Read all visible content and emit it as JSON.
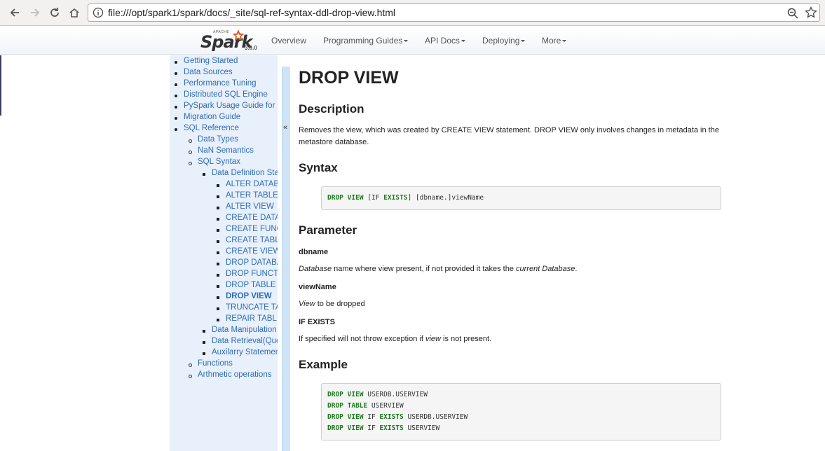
{
  "browser": {
    "url": "file:///opt/spark1/spark/docs/_site/sql-ref-syntax-ddl-drop-view.html"
  },
  "navbar": {
    "logo_small": "APACHE",
    "logo_text": "Spark",
    "version": "3.0.0",
    "items": [
      "Overview",
      "Programming Guides",
      "API Docs",
      "Deploying",
      "More"
    ]
  },
  "sidebar": {
    "items": [
      {
        "label": "Getting Started",
        "level": 0
      },
      {
        "label": "Data Sources",
        "level": 0
      },
      {
        "label": "Performance Tuning",
        "level": 0
      },
      {
        "label": "Distributed SQL Engine",
        "level": 0
      },
      {
        "label": "PySpark Usage Guide for P",
        "level": 0
      },
      {
        "label": "Migration Guide",
        "level": 0
      },
      {
        "label": "SQL Reference",
        "level": 0
      },
      {
        "label": "Data Types",
        "level": 1
      },
      {
        "label": "NaN Semantics",
        "level": 1
      },
      {
        "label": "SQL Syntax",
        "level": 1
      },
      {
        "label": "Data Definition Sta",
        "level": 2
      },
      {
        "label": "ALTER DATAB",
        "level": 3
      },
      {
        "label": "ALTER TABLE",
        "level": 3
      },
      {
        "label": "ALTER VIEW",
        "level": 3
      },
      {
        "label": "CREATE DATA",
        "level": 3
      },
      {
        "label": "CREATE FUNC",
        "level": 3
      },
      {
        "label": "CREATE TABL",
        "level": 3
      },
      {
        "label": "CREATE VIEW",
        "level": 3
      },
      {
        "label": "DROP DATABA",
        "level": 3
      },
      {
        "label": "DROP FUNCT",
        "level": 3
      },
      {
        "label": "DROP TABLE",
        "level": 3
      },
      {
        "label": "DROP VIEW",
        "level": 3,
        "active": true
      },
      {
        "label": "TRUNCATE TA",
        "level": 3
      },
      {
        "label": "REPAIR TABL",
        "level": 3
      },
      {
        "label": "Data Manipulation",
        "level": 2
      },
      {
        "label": "Data Retrieval(Que",
        "level": 2
      },
      {
        "label": "Auxilarry Statemen",
        "level": 2
      },
      {
        "label": "Functions",
        "level": 1
      },
      {
        "label": "Arthmetic operations",
        "level": 1
      }
    ],
    "collapse_glyph": "«"
  },
  "content": {
    "title": "DROP VIEW",
    "description_heading": "Description",
    "description_text": "Removes the view, which was created by CREATE VIEW statement. DROP VIEW only involves changes in metadata in the metastore database.",
    "syntax_heading": "Syntax",
    "syntax_code": {
      "kw1": "DROP",
      "kw2": "VIEW",
      "t1": " [IF ",
      "kw3": "EXISTS",
      "t2": "] [dbname.]viewName"
    },
    "parameter_heading": "Parameter",
    "params": [
      {
        "name": "dbname",
        "desc_em1": "Database",
        "desc_mid": " name where view present, if not provided it takes the ",
        "desc_em2": "current Database",
        "desc_end": "."
      },
      {
        "name": "viewName",
        "desc_em1": "View",
        "desc_mid": " to be dropped",
        "desc_em2": "",
        "desc_end": ""
      },
      {
        "name": "IF EXISTS",
        "desc_em1": "",
        "desc_mid": "If specified will not throw exception if ",
        "desc_em2": "view",
        "desc_end": " is not present."
      }
    ],
    "example_heading": "Example",
    "example_lines": [
      {
        "kw1": "DROP",
        "kw2": "VIEW",
        "rest1": " USERDB.USERVIEW",
        "kw3": "",
        "rest2": ""
      },
      {
        "kw1": "DROP",
        "kw2": "TABLE",
        "rest1": " USERVIEW",
        "kw3": "",
        "rest2": ""
      },
      {
        "kw1": "DROP",
        "kw2": "VIEW",
        "rest1": " IF ",
        "kw3": "EXISTS",
        "rest2": " USERDB.USERVIEW"
      },
      {
        "kw1": "DROP",
        "kw2": "VIEW",
        "rest1": " IF ",
        "kw3": "EXISTS",
        "rest2": " USERVIEW"
      }
    ]
  }
}
